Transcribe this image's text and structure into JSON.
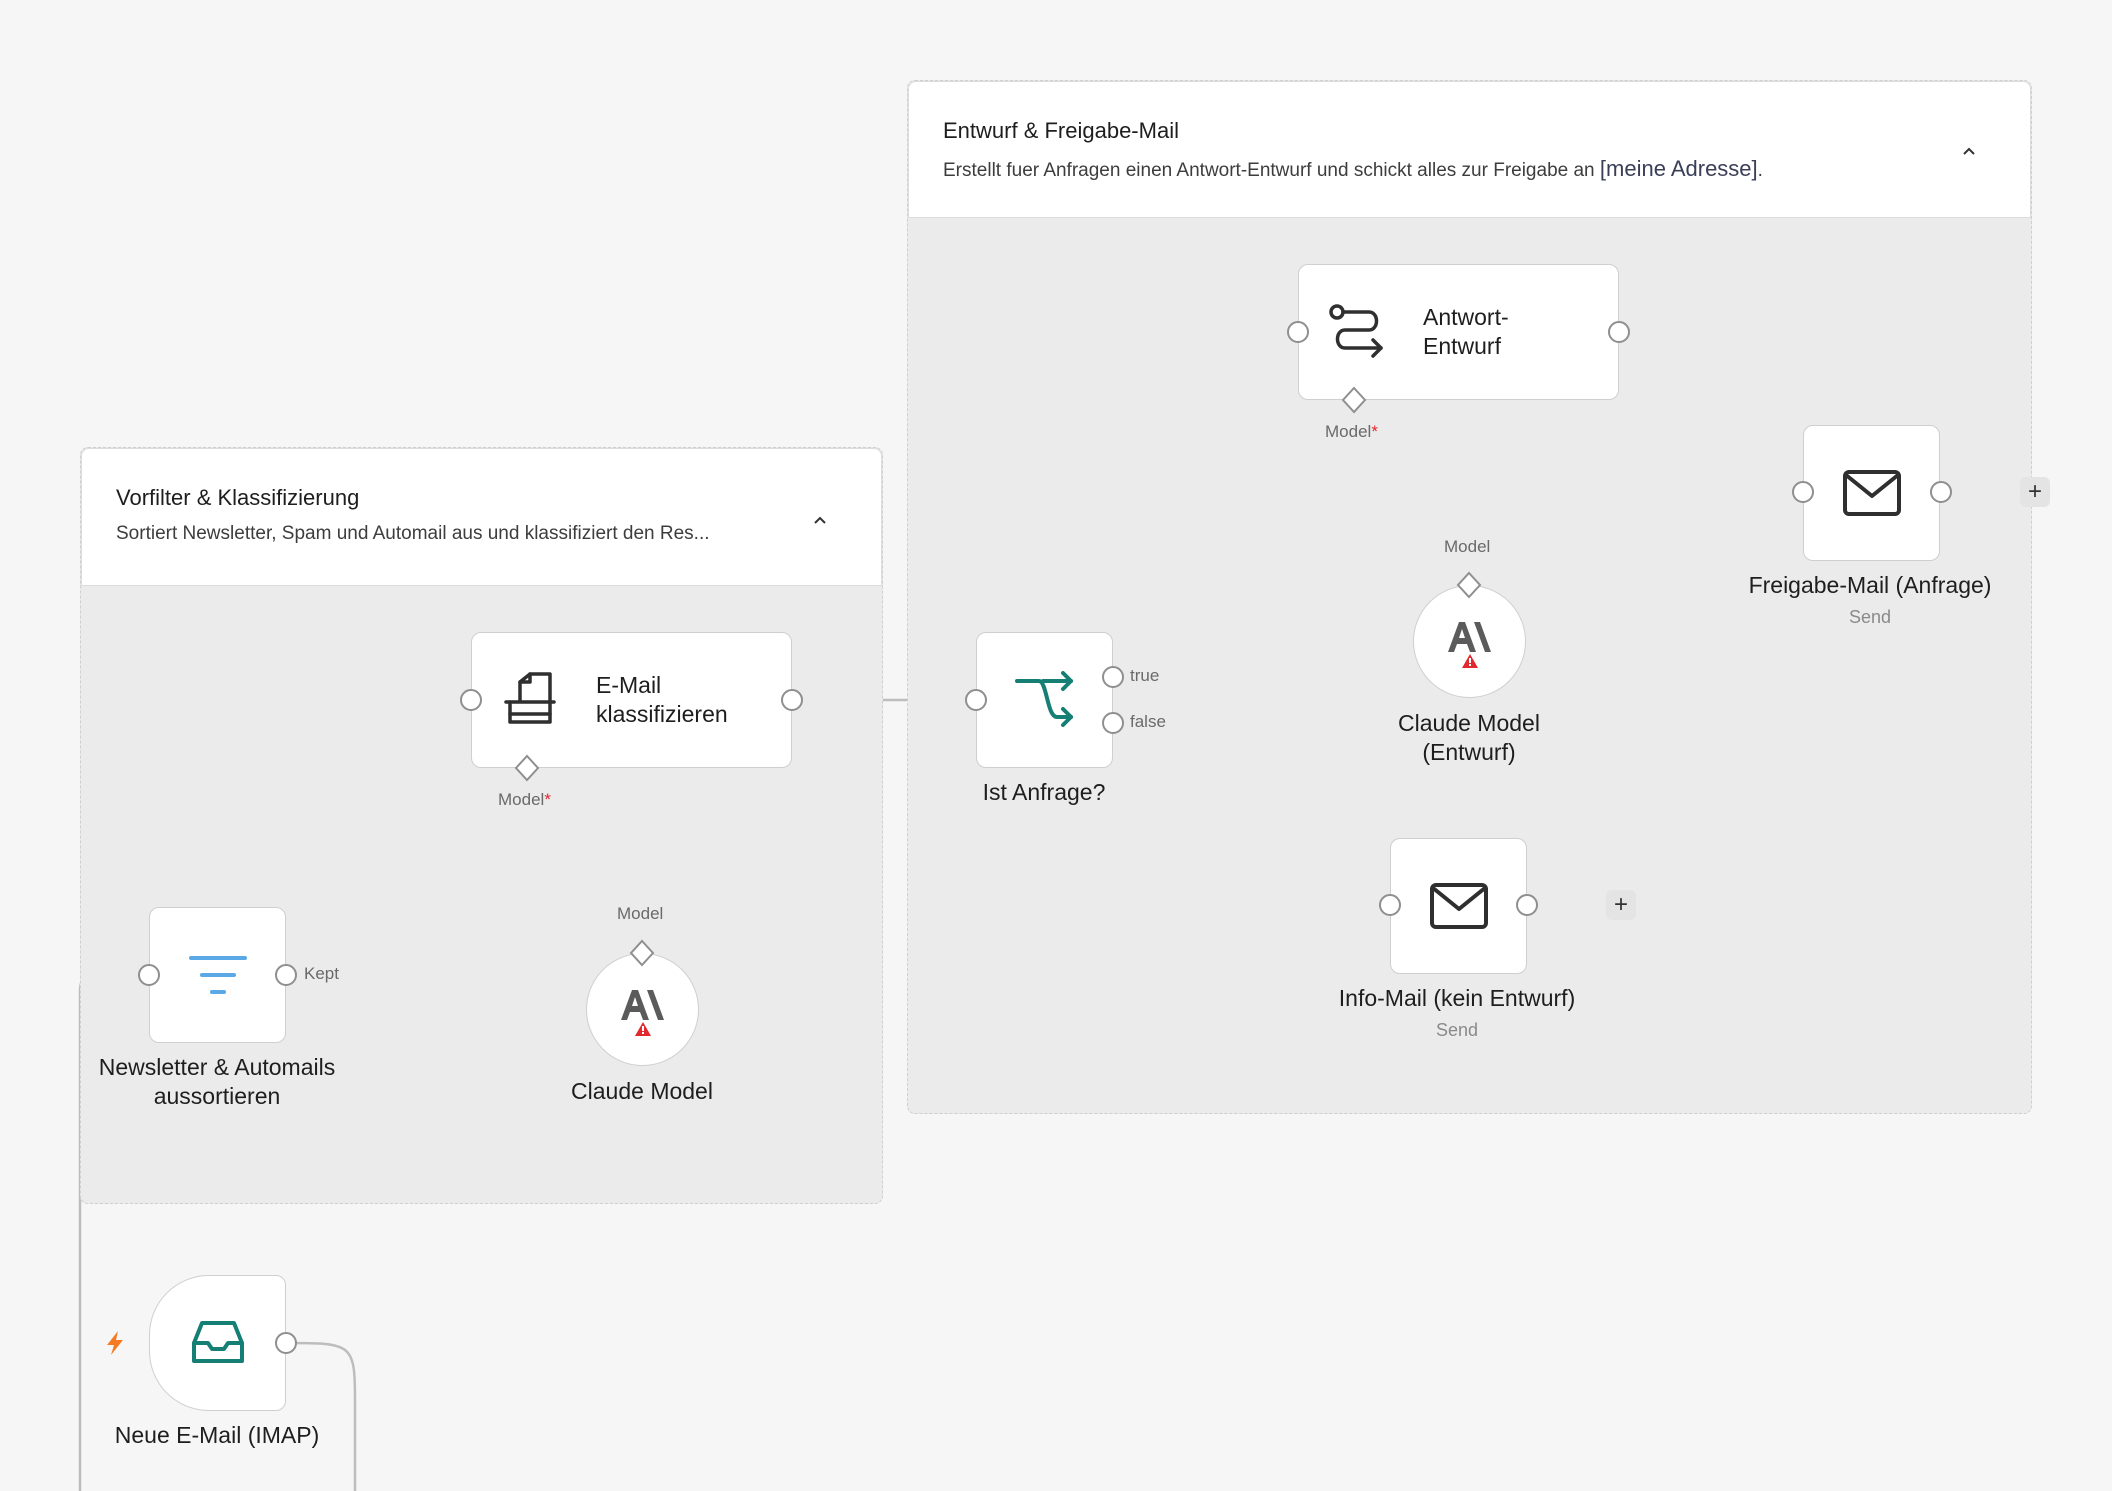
{
  "groups": {
    "vorfilter": {
      "title": "Vorfilter & Klassifizierung",
      "description": "Sortiert Newsletter, Spam und Automail aus und klassifiziert den Res..."
    },
    "entwurf": {
      "title": "Entwurf & Freigabe-Mail",
      "description": "Erstellt fuer Anfragen einen Antwort-Entwurf und schickt alles zur Freigabe an",
      "address": "[meine Adresse]",
      "description_end": "."
    }
  },
  "nodes": {
    "filter": {
      "title": "Newsletter & Automails aussortieren",
      "output_label": "Kept"
    },
    "classify": {
      "title": "E-Mail klassifizieren",
      "model_port": "Model"
    },
    "claude1": {
      "title": "Claude Model",
      "port": "Model"
    },
    "anfrage": {
      "title": "Ist Anfrage?",
      "true_label": "true",
      "false_label": "false"
    },
    "draft": {
      "title": "Antwort-Entwurf",
      "model_port": "Model"
    },
    "claude2": {
      "title": "Claude Model (Entwurf)",
      "port": "Model"
    },
    "freigabe": {
      "title": "Freigabe-Mail (Anfrage)",
      "subtitle": "Send"
    },
    "info": {
      "title": "Info-Mail (kein Entwurf)",
      "subtitle": "Send"
    },
    "trigger": {
      "title": "Neue E-Mail (IMAP)"
    }
  },
  "common": {
    "required_mark": "*",
    "plus": "+"
  },
  "colors": {
    "teal": "#167f75",
    "filter_blue": "#5aa9e6",
    "warning_red": "#e0282e",
    "trigger_orange": "#f57a22",
    "canvas_bg": "#f6f6f6",
    "group_bg": "#ebebeb"
  },
  "icons": {
    "filter": "filter-lines-icon",
    "classify": "document-classify-icon",
    "claude": "anthropic-logo-icon",
    "warning": "warning-triangle-icon",
    "if": "branch-icon",
    "draft": "route-icon",
    "mail": "envelope-icon",
    "trigger": "inbox-icon",
    "bolt": "lightning-icon"
  }
}
